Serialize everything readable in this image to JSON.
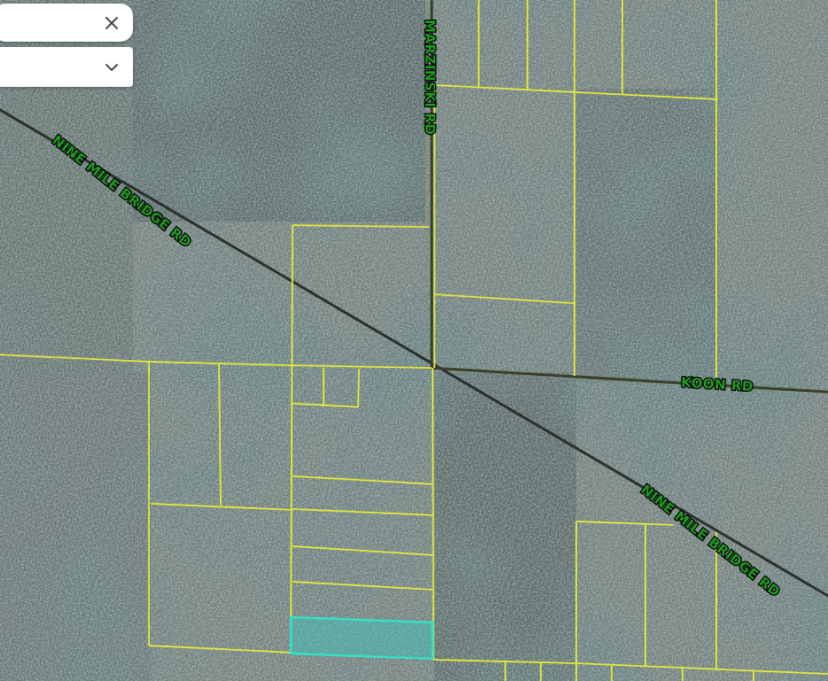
{
  "search": {
    "value": "",
    "close_icon": "close-icon"
  },
  "layer_select": {
    "selected": "",
    "toggle_icon": "chevron-down-icon"
  },
  "roads": [
    {
      "name": "NINE MILE BRIDGE RD"
    },
    {
      "name": "MARZINSKI RD"
    },
    {
      "name": "KOON RD"
    },
    {
      "name": "NINE MILE BRIDGE RD"
    }
  ],
  "colors": {
    "parcel_line": "#e4ea3a",
    "road_line": "#2a2f2c",
    "road_label_fill": "#1f9b1f",
    "selected_parcel_outline": "#35e0c4",
    "selected_parcel_fill": "#39c8c0"
  },
  "selected_parcel": {
    "highlighted": true
  }
}
